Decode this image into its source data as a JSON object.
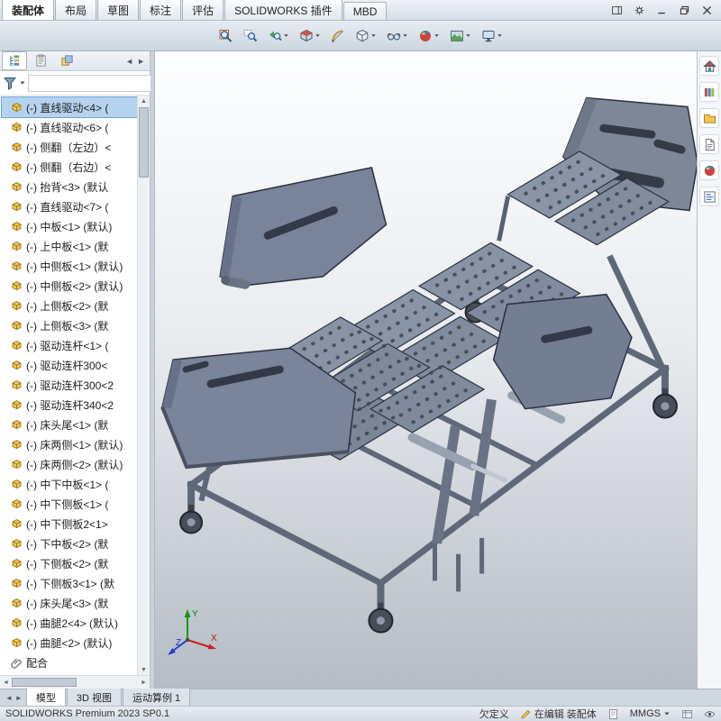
{
  "window": {
    "controls": [
      {
        "icon": "panel-toggle-icon",
        "name": "panel-toggle"
      },
      {
        "icon": "options-icon",
        "name": "options"
      },
      {
        "icon": "minimize-icon",
        "name": "minimize"
      },
      {
        "icon": "restore-icon",
        "name": "restore"
      },
      {
        "icon": "close-icon",
        "name": "close"
      }
    ]
  },
  "ribbon": {
    "tabs": [
      {
        "label": "装配体",
        "active": true
      },
      {
        "label": "布局",
        "active": false
      },
      {
        "label": "草图",
        "active": false
      },
      {
        "label": "标注",
        "active": false
      },
      {
        "label": "评估",
        "active": false
      },
      {
        "label": "SOLIDWORKS 插件",
        "active": false
      },
      {
        "label": "MBD",
        "active": false
      }
    ]
  },
  "headsup_toolbar": {
    "buttons": [
      {
        "icon": "zoom-fit-icon",
        "caret": false
      },
      {
        "icon": "zoom-area-icon",
        "caret": false
      },
      {
        "icon": "previous-view-icon",
        "caret": true
      },
      {
        "icon": "section-view-icon",
        "caret": true
      },
      {
        "icon": "measure-icon",
        "caret": false
      },
      {
        "icon": "display-style-icon",
        "caret": true
      },
      {
        "icon": "hide-show-icon",
        "caret": true
      },
      {
        "icon": "edit-appearance-icon",
        "caret": true
      },
      {
        "icon": "scene-icon",
        "caret": true
      },
      {
        "icon": "view-settings-icon",
        "caret": true
      }
    ]
  },
  "left_panel": {
    "tabs": [
      {
        "icon": "featuremanager-icon",
        "active": true
      },
      {
        "icon": "displaymanager-icon",
        "active": false
      },
      {
        "icon": "configurationmanager-icon",
        "active": false
      }
    ],
    "tab_arrow_left": "◄",
    "tab_arrow_right": "►",
    "filter_icon": "funnel-icon",
    "tree": {
      "items": [
        {
          "label": "(-) 直线驱动<4> (",
          "icon": "component-icon",
          "selected": true
        },
        {
          "label": "(-) 直线驱动<6> (",
          "icon": "component-icon",
          "selected": false
        },
        {
          "label": "(-) 侧翻（左边）<",
          "icon": "component-icon",
          "selected": false
        },
        {
          "label": "(-) 侧翻（右边）<",
          "icon": "component-icon",
          "selected": false
        },
        {
          "label": "(-) 抬背<3> (默认",
          "icon": "component-icon",
          "selected": false
        },
        {
          "label": "(-) 直线驱动<7> (",
          "icon": "component-icon",
          "selected": false
        },
        {
          "label": "(-) 中板<1> (默认)",
          "icon": "component-icon",
          "selected": false
        },
        {
          "label": "(-) 上中板<1> (默",
          "icon": "component-icon",
          "selected": false
        },
        {
          "label": "(-) 中侧板<1> (默认)",
          "icon": "component-icon",
          "selected": false
        },
        {
          "label": "(-) 中侧板<2> (默认)",
          "icon": "component-icon",
          "selected": false
        },
        {
          "label": "(-) 上侧板<2> (默",
          "icon": "component-icon",
          "selected": false
        },
        {
          "label": "(-) 上侧板<3> (默",
          "icon": "component-icon",
          "selected": false
        },
        {
          "label": "(-) 驱动连杆<1> (",
          "icon": "component-icon",
          "selected": false
        },
        {
          "label": "(-) 驱动连杆300<",
          "icon": "component-icon",
          "selected": false
        },
        {
          "label": "(-) 驱动连杆300<2",
          "icon": "component-icon",
          "selected": false
        },
        {
          "label": "(-) 驱动连杆340<2",
          "icon": "component-icon",
          "selected": false
        },
        {
          "label": "(-) 床头尾<1> (默",
          "icon": "component-icon",
          "selected": false
        },
        {
          "label": "(-) 床两侧<1> (默认)",
          "icon": "component-icon",
          "selected": false
        },
        {
          "label": "(-) 床两侧<2> (默认)",
          "icon": "component-icon",
          "selected": false
        },
        {
          "label": "(-) 中下中板<1> (",
          "icon": "component-icon",
          "selected": false
        },
        {
          "label": "(-) 中下侧板<1> (",
          "icon": "component-icon",
          "selected": false
        },
        {
          "label": "(-) 中下侧板2<1>",
          "icon": "component-icon",
          "selected": false
        },
        {
          "label": "(-) 下中板<2> (默",
          "icon": "component-icon",
          "selected": false
        },
        {
          "label": "(-) 下侧板<2> (默",
          "icon": "component-icon",
          "selected": false
        },
        {
          "label": "(-) 下侧板3<1> (默",
          "icon": "component-icon",
          "selected": false
        },
        {
          "label": "(-) 床头尾<3> (默",
          "icon": "component-icon",
          "selected": false
        },
        {
          "label": "(-) 曲腿2<4> (默认)",
          "icon": "component-icon",
          "selected": false
        },
        {
          "label": "(-) 曲腿<2> (默认)",
          "icon": "component-icon",
          "selected": false
        },
        {
          "label": "配合",
          "icon": "mates-icon",
          "selected": false
        }
      ]
    }
  },
  "scrollbar": {
    "up": "▲",
    "down": "▼",
    "left": "◄",
    "right": "►"
  },
  "viewport": {
    "triad": {
      "x": "X",
      "y": "Y",
      "z": "Z"
    }
  },
  "task_pane": {
    "icons": [
      "home-icon",
      "design-library-icon",
      "file-explorer-icon",
      "view-palette-icon",
      "appearances-icon",
      "custom-properties-icon"
    ]
  },
  "view_tabs": {
    "arrow_left": "◄",
    "arrow_right": "►",
    "tabs": [
      {
        "label": "模型",
        "active": true
      },
      {
        "label": "3D 视图",
        "active": false
      },
      {
        "label": "运动算例 1",
        "active": false
      }
    ]
  },
  "status_bar": {
    "app_version": "SOLIDWORKS Premium 2023 SP0.1",
    "definition": "欠定义",
    "editing": "在编辑 装配体",
    "units": "MMGS"
  },
  "colors": {
    "selection": "#b5d3ef",
    "panel_metal": "#8690a3",
    "frame_metal": "#5f6879",
    "viewport_top": "#fdfeff",
    "viewport_bottom": "#b6bcc5",
    "accent": "#2a6496"
  }
}
